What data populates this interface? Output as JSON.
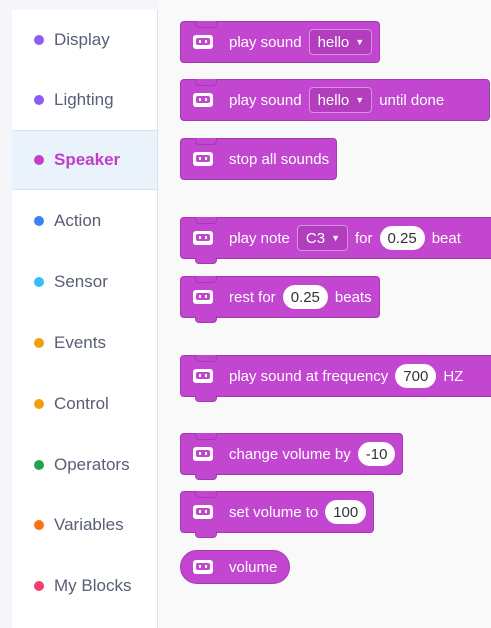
{
  "sidebar": {
    "items": [
      {
        "label": "Display",
        "color": "#8b5cf6"
      },
      {
        "label": "Lighting",
        "color": "#8b5cf6"
      },
      {
        "label": "Speaker",
        "color": "#c23ec6",
        "active": true
      },
      {
        "label": "Action",
        "color": "#3b82f6"
      },
      {
        "label": "Sensor",
        "color": "#38bdf8"
      },
      {
        "label": "Events",
        "color": "#f59e0b"
      },
      {
        "label": "Control",
        "color": "#f59e0b"
      },
      {
        "label": "Operators",
        "color": "#22a34a"
      },
      {
        "label": "Variables",
        "color": "#f97316"
      },
      {
        "label": "My Blocks",
        "color": "#f43f6e"
      }
    ]
  },
  "blocks": {
    "play_sound": {
      "text": "play sound",
      "sound": "hello"
    },
    "play_sound_until_done": {
      "text": "play sound",
      "sound": "hello",
      "suffix": "until done"
    },
    "stop_all_sounds": {
      "text": "stop all sounds"
    },
    "play_note": {
      "text": "play note",
      "note": "C3",
      "for": "for",
      "beats_value": "0.25",
      "beats": "beat"
    },
    "rest_for": {
      "text": "rest for",
      "value": "0.25",
      "suffix": "beats"
    },
    "play_frequency": {
      "text": "play sound at frequency",
      "value": "700",
      "suffix": "HZ"
    },
    "change_volume": {
      "text": "change volume by",
      "value": "-10"
    },
    "set_volume": {
      "text": "set volume to",
      "value": "100"
    },
    "volume": {
      "text": "volume"
    }
  },
  "colors": {
    "block": "#c346d1",
    "block_border": "#a33bb0",
    "active_label": "#c23ec6"
  },
  "icons": {
    "block_icon": "robot-face-icon",
    "dropdown": "caret-down-icon"
  }
}
